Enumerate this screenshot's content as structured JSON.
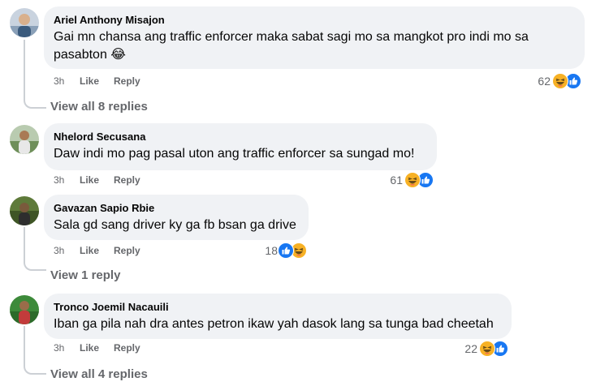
{
  "comments": [
    {
      "author": "Ariel Anthony Misajon",
      "text": "Gai mn chansa ang traffic enforcer maka sabat sagi mo sa mangkot pro indi mo sa pasabton 😂",
      "time": "3h",
      "like": "Like",
      "reply": "Reply",
      "reaction_count": "62",
      "reactions": [
        "haha-icon",
        "like-icon"
      ],
      "view_replies": "View all 8 replies"
    },
    {
      "author": "Nhelord Secusana",
      "text": "Daw indi mo pag pasal uton ang traffic enforcer sa sungad mo!",
      "time": "3h",
      "like": "Like",
      "reply": "Reply",
      "reaction_count": "61",
      "reactions": [
        "haha-icon",
        "like-icon"
      ]
    },
    {
      "author": "Gavazan Sapio Rbie",
      "text": "Sala gd sang driver ky ga fb bsan ga drive",
      "time": "3h",
      "like": "Like",
      "reply": "Reply",
      "reaction_count": "18",
      "reactions": [
        "like-icon",
        "haha-icon"
      ],
      "view_replies": "View 1 reply"
    },
    {
      "author": "Tronco Joemil Nacauili",
      "text": "Iban ga pila nah dra antes petron ikaw yah dasok lang sa tunga bad cheetah",
      "time": "3h",
      "like": "Like",
      "reply": "Reply",
      "reaction_count": "22",
      "reactions": [
        "haha-icon",
        "like-icon"
      ],
      "view_replies": "View all 4 replies"
    }
  ],
  "colors": {
    "bubble": "#f0f2f5",
    "meta_text": "#65676b",
    "like_blue": "#1877f2",
    "haha_yellow": "#f7b125",
    "thread_line": "#ccd0d5"
  }
}
